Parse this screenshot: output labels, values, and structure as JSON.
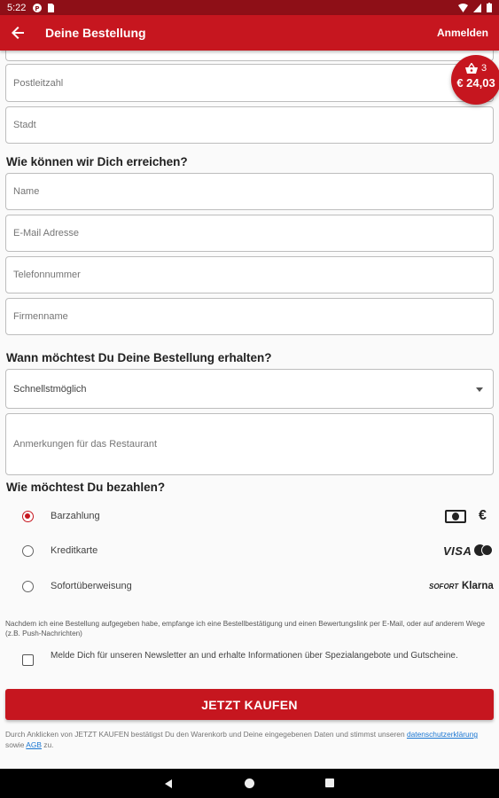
{
  "status_bar": {
    "time": "5:22"
  },
  "app_bar": {
    "title": "Deine Bestellung",
    "login_label": "Anmelden"
  },
  "cart": {
    "count": "3",
    "total": "€ 24,03"
  },
  "address": {
    "postal_code_placeholder": "Postleitzahl",
    "city_placeholder": "Stadt"
  },
  "contact": {
    "heading": "Wie können wir Dich erreichen?",
    "name_placeholder": "Name",
    "email_placeholder": "E-Mail Adresse",
    "phone_placeholder": "Telefonnummer",
    "company_placeholder": "Firmenname"
  },
  "delivery": {
    "heading": "Wann möchtest Du Deine Bestellung erhalten?",
    "time_selected": "Schnellstmöglich",
    "notes_placeholder": "Anmerkungen für das Restaurant"
  },
  "payment": {
    "heading": "Wie möchtest Du bezahlen?",
    "options": [
      {
        "label": "Barzahlung",
        "selected": true,
        "icons": [
          "cash-icon",
          "euro-icon"
        ]
      },
      {
        "label": "Kreditkarte",
        "selected": false,
        "icons": [
          "visa-icon",
          "mastercard-icon"
        ]
      },
      {
        "label": "Sofortüberweisung",
        "selected": false,
        "icons": [
          "sofort-icon",
          "klarna-icon"
        ]
      }
    ],
    "visa_text": "VISA",
    "sofort_text": "SOFORT",
    "klarna_text": "Klarna"
  },
  "notice_text": "Nachdem ich eine Bestellung aufgegeben habe, empfange ich eine Bestellbestätigung und einen Bewertungslink per E-Mail, oder auf anderem Wege (z.B. Push-Nachrichten)",
  "newsletter": {
    "checked": false,
    "label": "Melde Dich für unseren Newsletter an und erhalte Informationen über Spezialangebote und Gutscheine."
  },
  "buy_button_label": "JETZT KAUFEN",
  "legal": {
    "prefix": "Durch Anklicken von JETZT KAUFEN bestätigst Du den Warenkorb und Deine eingegebenen Daten und stimmst unseren ",
    "privacy_link": "datenschutzerklärung",
    "middle": " sowie ",
    "terms_link": "AGB",
    "suffix": " zu."
  },
  "colors": {
    "primary": "#c6161f",
    "status_bar": "#8e0f17",
    "link": "#1976d2"
  }
}
